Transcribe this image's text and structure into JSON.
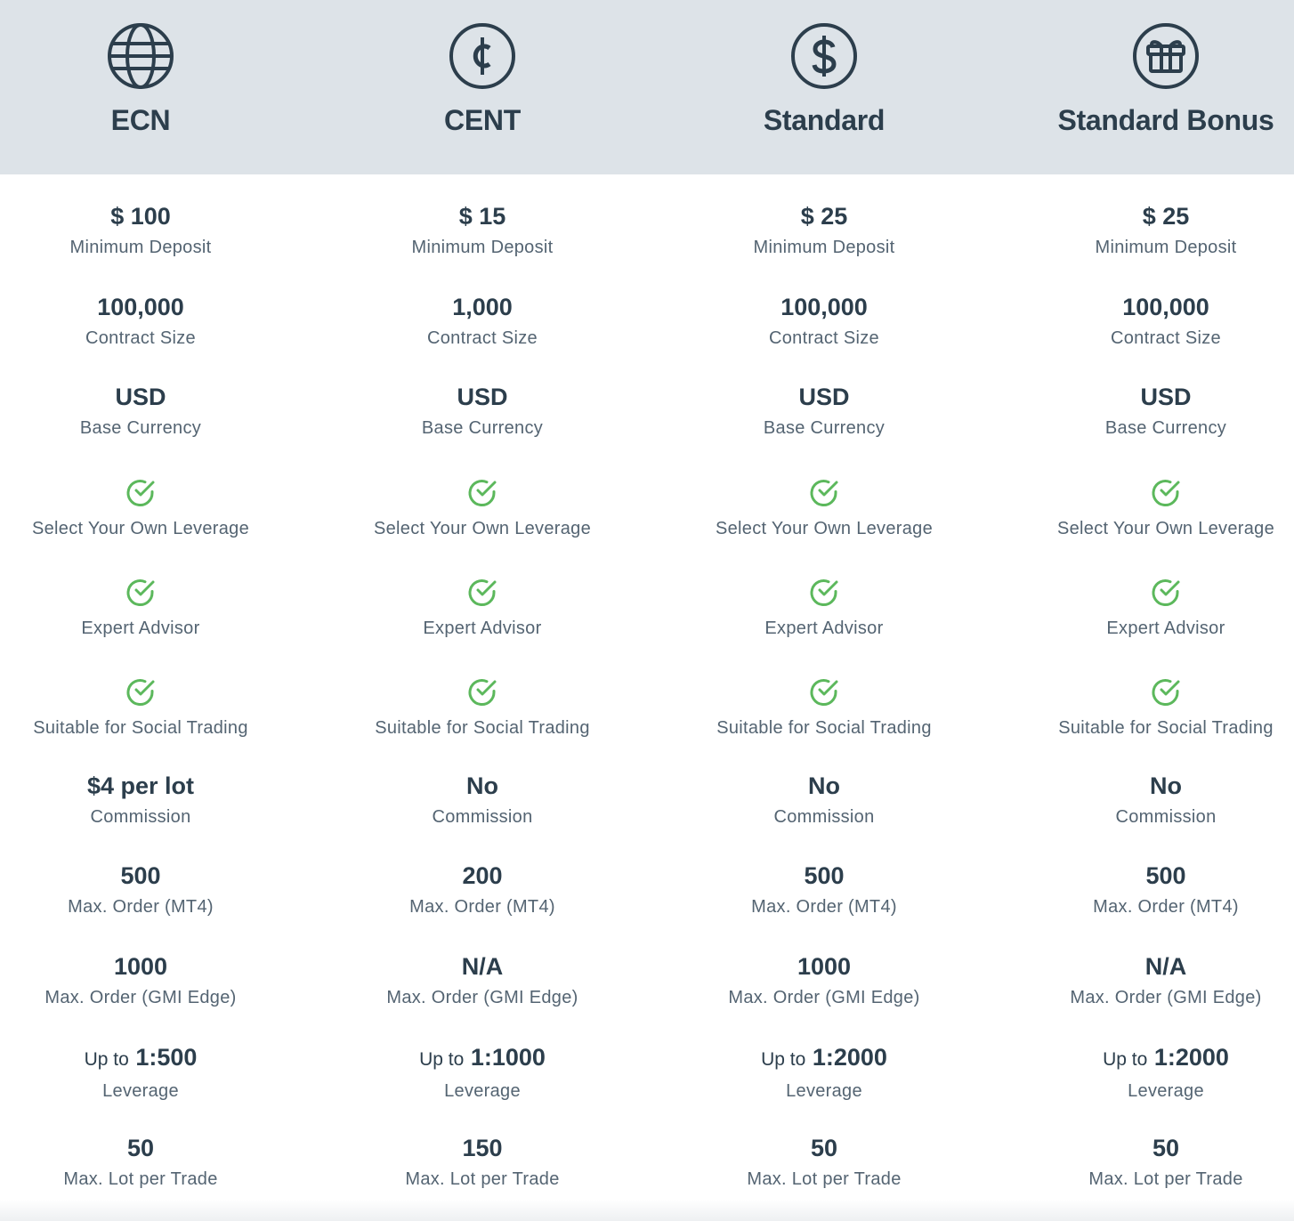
{
  "plans": [
    {
      "icon": "globe-icon",
      "name": "ECN",
      "min_deposit": "$ 100",
      "contract_size": "100,000",
      "base_currency": "USD",
      "commission": "$4 per lot",
      "max_order_mt4": "500",
      "max_order_gmi": "1000",
      "leverage_prefix": "Up to",
      "leverage": "1:500",
      "max_lot": "50"
    },
    {
      "icon": "cent-icon",
      "name": "CENT",
      "min_deposit": "$ 15",
      "contract_size": "1,000",
      "base_currency": "USD",
      "commission": "No",
      "max_order_mt4": "200",
      "max_order_gmi": "N/A",
      "leverage_prefix": "Up to",
      "leverage": "1:1000",
      "max_lot": "150"
    },
    {
      "icon": "dollar-icon",
      "name": "Standard",
      "min_deposit": "$ 25",
      "contract_size": "100,000",
      "base_currency": "USD",
      "commission": "No",
      "max_order_mt4": "500",
      "max_order_gmi": "1000",
      "leverage_prefix": "Up to",
      "leverage": "1:2000",
      "max_lot": "50"
    },
    {
      "icon": "gift-icon",
      "name": "Standard Bonus",
      "min_deposit": "$ 25",
      "contract_size": "100,000",
      "base_currency": "USD",
      "commission": "No",
      "max_order_mt4": "500",
      "max_order_gmi": "N/A",
      "leverage_prefix": "Up to",
      "leverage": "1:2000",
      "max_lot": "50"
    }
  ],
  "labels": {
    "min_deposit": "Minimum Deposit",
    "contract_size": "Contract Size",
    "base_currency": "Base Currency",
    "leverage_select": "Select Your Own Leverage",
    "expert_advisor": "Expert Advisor",
    "social_trading": "Suitable for Social Trading",
    "commission": "Commission",
    "max_order_mt4": "Max. Order (MT4)",
    "max_order_gmi": "Max. Order (GMI Edge)",
    "leverage": "Leverage",
    "max_lot": "Max. Lot per Trade"
  },
  "colors": {
    "header_bg": "#dde3e8",
    "text_dark": "#2c3e4c",
    "text_label": "#546472",
    "check_green": "#5cb85c"
  },
  "check_icon": "check-circle-icon"
}
